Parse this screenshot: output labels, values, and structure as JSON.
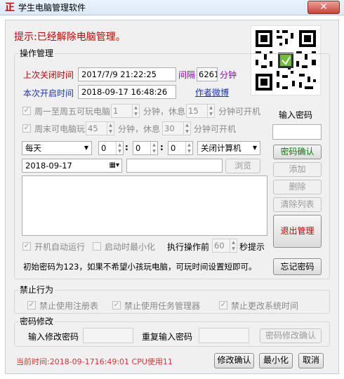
{
  "window": {
    "icon": "正",
    "title": "学生电脑管理软件",
    "close": "✕"
  },
  "hint": "提示:已经解除电脑管理。",
  "ops": {
    "title": "操作管理",
    "last_close_label": "上次关闭时间",
    "last_close_value": "2017/7/9 21:22:25",
    "interval_label": "间隔",
    "interval_value": "6261",
    "interval_unit": "分钟",
    "this_open_label": "本次开启时间",
    "this_open_value": "2018-09-17 16:48:26",
    "author_link": "作者微博",
    "weekday_label": "周一至周五可玩电脑",
    "weekday_play": "1",
    "unit_min_rest": "分钟，休息",
    "weekday_rest": "15",
    "unit_min_ok": "分钟可开机",
    "weekend_label": "周末可电脑玩",
    "weekend_play": "45",
    "weekend_rest": "30",
    "unit_min_ok2": "分钟可开机",
    "freq": "每天",
    "hour": "0",
    "minute": "0",
    "second": "0",
    "colon": ":",
    "action": "关闭计算机",
    "date": "2018-09-17",
    "browse": "浏览",
    "autostart_label": "开机自动运行",
    "minimize_label": "启动时最小化",
    "before_label": "执行操作前",
    "before_value": "60",
    "before_unit": "秒提示",
    "note": "初始密码为123，如果不希望小孩玩电脑，可玩时间设置短即可。"
  },
  "right": {
    "pwd_label": "输入密码",
    "pwd_value": "",
    "confirm": "密码确认",
    "add": "添加",
    "delete": "删除",
    "clear": "清除列表",
    "exit": "退出管理",
    "forgot": "忘记密码"
  },
  "forbid": {
    "title": "禁止行为",
    "registry": "禁止使用注册表",
    "taskmgr": "禁止使用任务管理器",
    "systime": "禁止更改系统时间"
  },
  "pwdchange": {
    "title": "密码修改",
    "new_label": "输入修改密码",
    "repeat_label": "重复输入密码",
    "confirm": "密码修改确认"
  },
  "status": {
    "text": "当前时间:2018-09-1716:49:01 CPU使用11"
  },
  "bottom": {
    "modify": "修改确认",
    "minimize": "最小化",
    "cancel": "取消"
  },
  "colors": {
    "accent_red": "#cc0000",
    "accent_blue": "#1a33c8",
    "purple": "#9a00c8",
    "green": "#008000"
  }
}
